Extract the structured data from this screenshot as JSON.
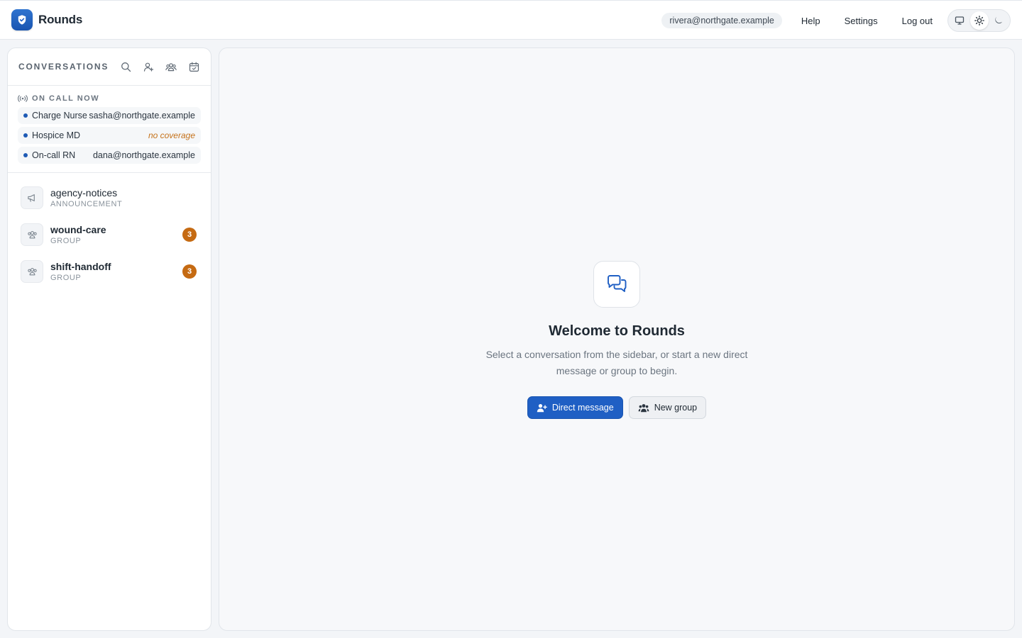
{
  "app": {
    "name": "Rounds",
    "brand_color": "#1f5fc4"
  },
  "header": {
    "user_email": "rivera@northgate.example",
    "links": {
      "help": "Help",
      "settings": "Settings",
      "logout": "Log out"
    },
    "theme_options": [
      "monitor-icon",
      "sun-icon",
      "moon-icon"
    ],
    "active_theme": "sun-icon"
  },
  "sidebar": {
    "title": "CONVERSATIONS",
    "head_icons": [
      "search-icon",
      "new-dm-icon",
      "new-group-icon",
      "calendar-icon",
      "announcement-icon"
    ],
    "oncall": {
      "title": "ON CALL NOW",
      "rows": [
        {
          "role": "Charge Nurse",
          "value": "sasha@northgate.example",
          "warn": false
        },
        {
          "role": "Hospice MD",
          "value": "no coverage",
          "warn": true
        },
        {
          "role": "On-call RN",
          "value": "dana@northgate.example",
          "warn": false
        }
      ]
    },
    "conversations": [
      {
        "name": "agency-notices",
        "kind": "ANNOUNCEMENT",
        "unread": null,
        "icon": "megaphone-icon"
      },
      {
        "name": "wound-care",
        "kind": "GROUP",
        "unread": "3",
        "icon": "group-icon"
      },
      {
        "name": "shift-handoff",
        "kind": "GROUP",
        "unread": "3",
        "icon": "group-icon"
      }
    ]
  },
  "main": {
    "welcome_title": "Welcome to Rounds",
    "welcome_text": "Select a conversation from the sidebar, or start a new direct message or group to begin.",
    "buttons": {
      "direct_message": "Direct message",
      "new_group": "New group"
    }
  },
  "colors": {
    "accent": "#1f5fc4",
    "badge": "#c56a12",
    "warning_text": "#c5721b"
  }
}
